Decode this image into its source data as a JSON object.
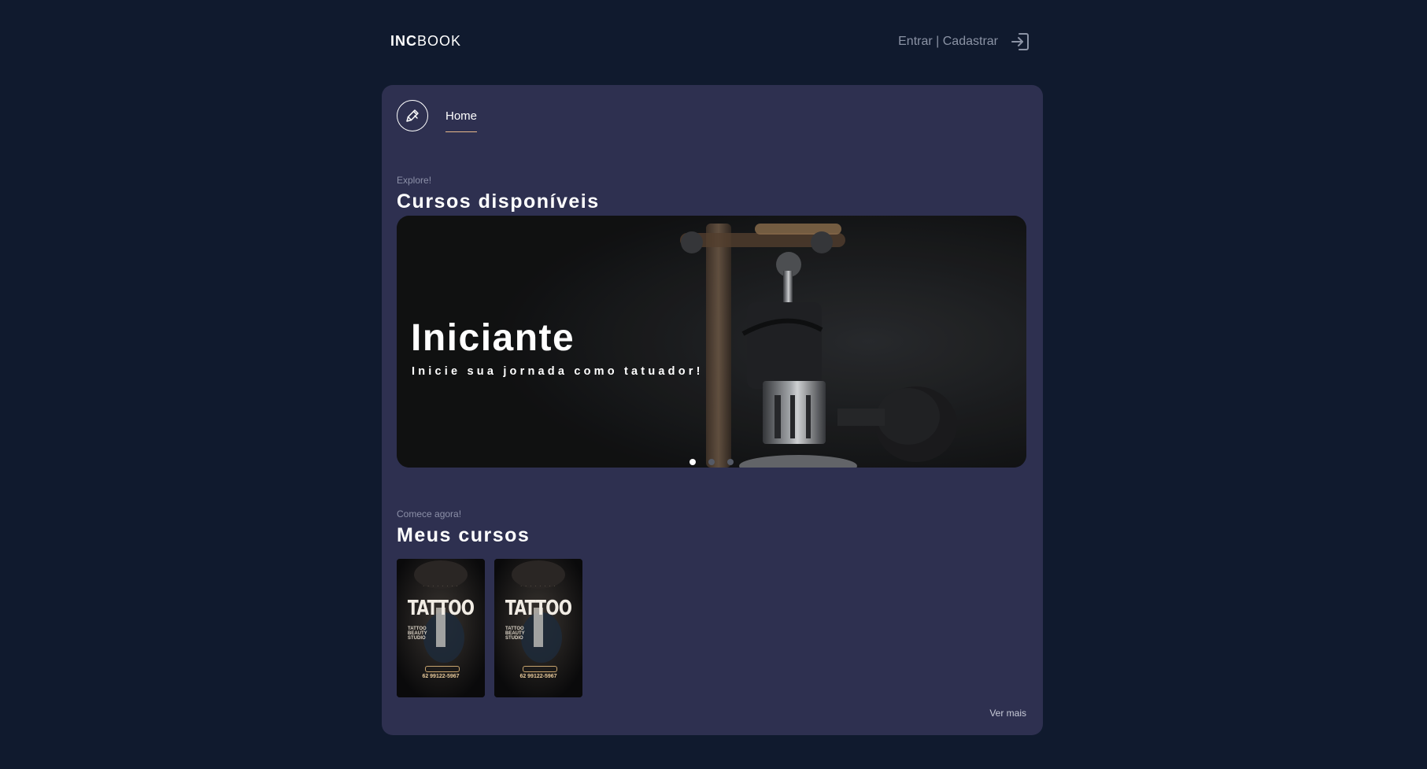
{
  "header": {
    "logo_bold": "INC",
    "logo_light": "BOOK",
    "auth_label": "Entrar | Cadastrar",
    "auth_icon": "sign-in-icon"
  },
  "nav": {
    "logo_icon": "pen-icon",
    "tabs": [
      {
        "label": "Home",
        "active": true
      }
    ]
  },
  "available_section": {
    "eyebrow": "Explore!",
    "title": "Cursos disponíveis"
  },
  "carousel": {
    "slides_count": 3,
    "active_index": 0,
    "title": "Iniciante",
    "subtitle": "Inicie sua jornada como tatuador!"
  },
  "my_courses_section": {
    "eyebrow": "Comece agora!",
    "title": "Meus cursos",
    "cards": [
      {
        "title": "TATTOO",
        "side_text": [
          "TATTOO",
          "BEAUTY",
          "STUDIO"
        ],
        "phone": "62 99122-5967"
      },
      {
        "title": "TATTOO",
        "side_text": [
          "TATTOO",
          "BEAUTY",
          "STUDIO"
        ],
        "phone": "62 99122-5967"
      }
    ],
    "see_more": "Ver mais"
  },
  "colors": {
    "page_bg": "#101a2e",
    "card_bg": "#2e3050",
    "accent": "#e8b98a",
    "muted_text": "#8b93a5"
  }
}
